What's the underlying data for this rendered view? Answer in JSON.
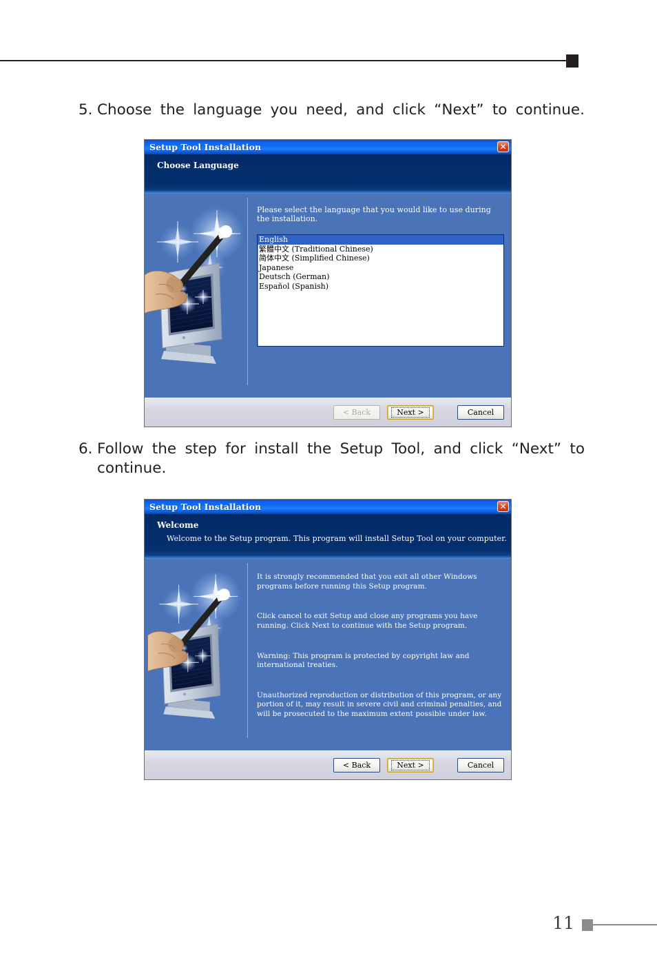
{
  "page": {
    "number": "11"
  },
  "steps": [
    {
      "num": "5.",
      "text": "Choose the language you need, and click “Next” to continue."
    },
    {
      "num": "6.",
      "line1": "Follow the step for install the Setup Tool, and click “Next” to",
      "line2": "continue."
    }
  ],
  "dialog_language": {
    "titlebar": {
      "title": "Setup Tool Installation",
      "close_label": "✕"
    },
    "header": {
      "heading": "Choose Language"
    },
    "prompt": "Please select the language that you would like to use during the installation.",
    "languages": [
      {
        "label": "English",
        "selected": true
      },
      {
        "label": "繁體中文 (Traditional Chinese)",
        "selected": false
      },
      {
        "label": "简体中文 (Simplified Chinese)",
        "selected": false
      },
      {
        "label": "Japanese",
        "selected": false
      },
      {
        "label": "Deutsch (German)",
        "selected": false
      },
      {
        "label": "Español (Spanish)",
        "selected": false
      }
    ],
    "buttons": {
      "back": "< Back",
      "next": "Next >",
      "cancel": "Cancel",
      "back_enabled": false,
      "next_is_default": true
    }
  },
  "dialog_welcome": {
    "titlebar": {
      "title": "Setup Tool Installation",
      "close_label": "✕"
    },
    "header": {
      "heading": "Welcome",
      "subheading": "Welcome to the Setup program. This program will install Setup Tool on your computer."
    },
    "paragraphs": [
      "It is strongly recommended that you exit all other Windows programs before running this Setup program.",
      "Click cancel to exit Setup and close any programs you have running. Click Next to continue with the Setup program.",
      "Warning: This program is protected by copyright law and international treaties.",
      "Unauthorized reproduction or distribution of this program, or any portion of it, may result in severe civil and criminal penalties, and will be prosecuted to the maximum extent possible under law."
    ],
    "buttons": {
      "back": "< Back",
      "next": "Next >",
      "cancel": "Cancel",
      "back_enabled": true,
      "next_is_default": true
    }
  },
  "colors": {
    "titlebar_blue": "#0f6df5",
    "header_navy": "#042a66",
    "body_blue": "#4a73b8",
    "selection_blue": "#2f62c8",
    "close_red": "#c62f14",
    "rule_black": "#231f20",
    "footer_gray": "#8c8c8c"
  }
}
